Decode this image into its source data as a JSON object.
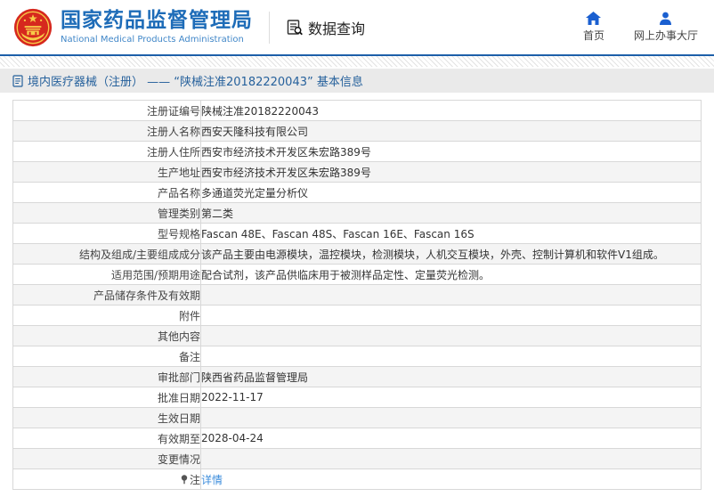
{
  "header": {
    "logo": {
      "title": "国家药品监督管理局",
      "subtitle": "National Medical Products Administration",
      "emblem_icon": "national-emblem"
    },
    "data_query": {
      "label": "数据查询",
      "icon": "doc-search-icon"
    },
    "nav": [
      {
        "label": "首页",
        "icon": "home-icon"
      },
      {
        "label": "网上办事大厅",
        "icon": "person-icon"
      }
    ]
  },
  "breadcrumb": {
    "icon": "document-icon",
    "text": "境内医疗器械（注册） —— “陕械注准20182220043” 基本信息"
  },
  "table": {
    "rows": [
      {
        "label": "注册证编号",
        "value": "陕械注准20182220043"
      },
      {
        "label": "注册人名称",
        "value": "西安天隆科技有限公司"
      },
      {
        "label": "注册人住所",
        "value": "西安市经济技术开发区朱宏路389号"
      },
      {
        "label": "生产地址",
        "value": "西安市经济技术开发区朱宏路389号"
      },
      {
        "label": "产品名称",
        "value": "多通道荧光定量分析仪"
      },
      {
        "label": "管理类别",
        "value": "第二类"
      },
      {
        "label": "型号规格",
        "value": "Fascan 48E、Fascan 48S、Fascan 16E、Fascan 16S"
      },
      {
        "label": "结构及组成/主要组成成分",
        "value": "该产品主要由电源模块，温控模块，检测模块，人机交互模块，外壳、控制计算机和软件V1组成。"
      },
      {
        "label": "适用范围/预期用途",
        "value": "配合试剂，该产品供临床用于被测样品定性、定量荧光检测。"
      },
      {
        "label": "产品储存条件及有效期",
        "value": ""
      },
      {
        "label": "附件",
        "value": ""
      },
      {
        "label": "其他内容",
        "value": ""
      },
      {
        "label": "备注",
        "value": ""
      },
      {
        "label": "审批部门",
        "value": "陕西省药品监督管理局"
      },
      {
        "label": "批准日期",
        "value": "2022-11-17"
      },
      {
        "label": "生效日期",
        "value": ""
      },
      {
        "label": "有效期至",
        "value": "2028-04-24"
      },
      {
        "label": "变更情况",
        "value": ""
      },
      {
        "label": "注",
        "label_icon": "pin-icon",
        "value": "详情",
        "value_is_link": true
      }
    ]
  },
  "colors": {
    "brand_blue": "#1e6cb8",
    "header_rule": "#1d5fa9",
    "nav_icon_blue": "#1a5fd0",
    "link_blue": "#3c8ddc",
    "breadcrumb_text": "#26619c",
    "breadcrumb_bg": "#eaeaea",
    "row_alt_bg": "#f4f4f4",
    "table_border": "#d8d8d8",
    "emblem_red": "#d6281e",
    "emblem_gold": "#f7c948",
    "text_dark": "#333333"
  }
}
